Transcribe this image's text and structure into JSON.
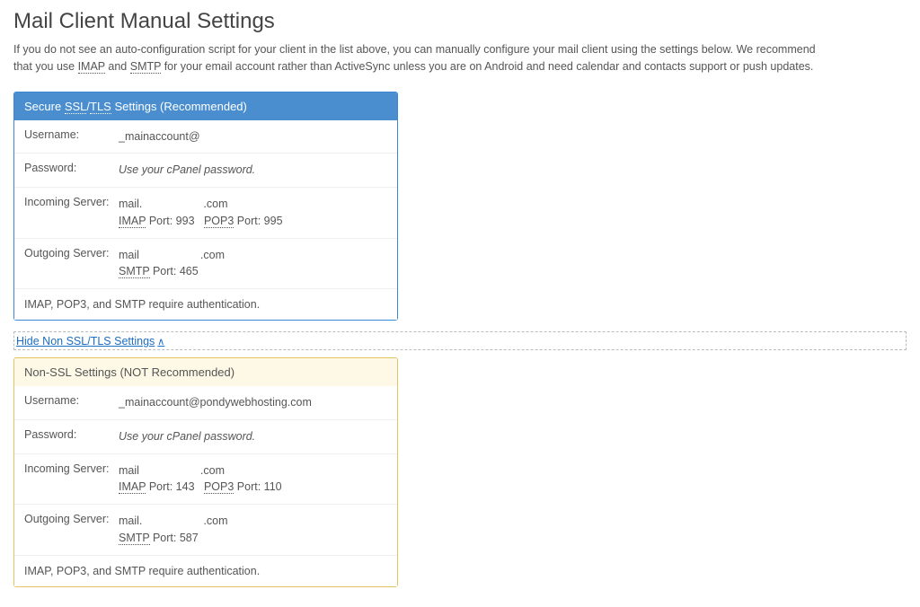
{
  "page": {
    "title": "Mail Client Manual Settings",
    "intro_pre": "If you do not see an auto-configuration script for your client in the list above, you can manually configure your mail client using the settings below. We recommend that you use ",
    "intro_imap": "IMAP",
    "intro_and": " and ",
    "intro_smtp": "SMTP",
    "intro_post": " for your email account rather than ActiveSync unless you are on Android and need calendar and contacts support or push updates."
  },
  "secure": {
    "header_pre": "Secure ",
    "header_ssl": "SSL",
    "header_slash": "/",
    "header_tls": "TLS",
    "header_post": " Settings (Recommended)",
    "username_label": "Username:",
    "username_value": "_mainaccount@",
    "password_label": "Password:",
    "password_value": "Use your cPanel password.",
    "incoming_label": "Incoming Server:",
    "incoming_host_pre": "mail.",
    "incoming_host_suf": ".com",
    "incoming_imap": "IMAP",
    "incoming_imap_port": " Port: 993",
    "incoming_pop3": "POP3",
    "incoming_pop3_port": " Port: 995",
    "outgoing_label": "Outgoing Server:",
    "outgoing_host_pre": "mail",
    "outgoing_host_suf": ".com",
    "outgoing_smtp": "SMTP",
    "outgoing_smtp_port": " Port: 465",
    "note": "IMAP, POP3, and SMTP require authentication."
  },
  "toggle": {
    "label_pre": "Hide Non ",
    "label_ssl": "SSL",
    "label_slash": "/",
    "label_tls": "TLS",
    "label_post": " Settings"
  },
  "nonssl": {
    "header": "Non-SSL Settings (NOT Recommended)",
    "username_label": "Username:",
    "username_value": "_mainaccount@pondywebhosting.com",
    "password_label": "Password:",
    "password_value": "Use your cPanel password.",
    "incoming_label": "Incoming Server:",
    "incoming_host_pre": "mail",
    "incoming_host_suf": ".com",
    "incoming_imap": "IMAP",
    "incoming_imap_port": " Port: 143",
    "incoming_pop3": "POP3",
    "incoming_pop3_port": " Port: 110",
    "outgoing_label": "Outgoing Server:",
    "outgoing_host_pre": "mail.",
    "outgoing_host_suf": ".com",
    "outgoing_smtp": "SMTP",
    "outgoing_smtp_port": " Port: 587",
    "note": "IMAP, POP3, and SMTP require authentication."
  }
}
